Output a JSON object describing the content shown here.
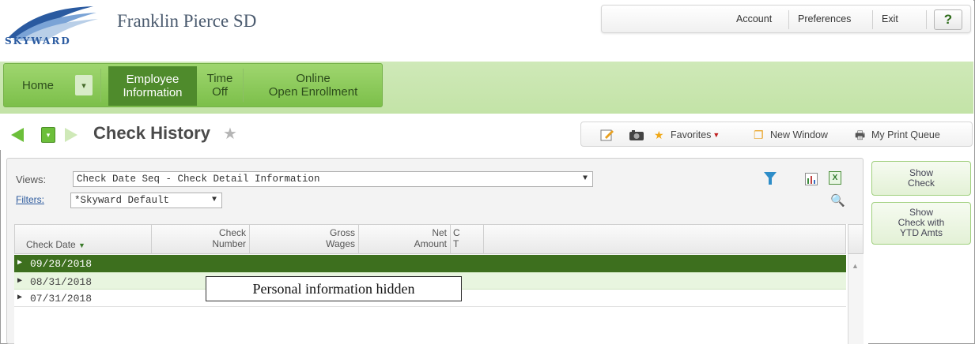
{
  "header": {
    "logo_text": "SKYWARD",
    "district": "Franklin Pierce SD",
    "menu": [
      "Account",
      "Preferences",
      "Exit"
    ],
    "help": "?"
  },
  "nav": {
    "home": "Home",
    "dropdown": "▾",
    "employee_information": "Employee\nInformation",
    "time_off": "Time\nOff",
    "online_open_enrollment": "Online\nOpen Enrollment"
  },
  "page": {
    "title": "Check History",
    "toolbar": {
      "favorites": "Favorites",
      "new_window": "New Window",
      "print_queue": "My Print Queue"
    }
  },
  "filters": {
    "views_label": "Views:",
    "views_value": "Check Date Seq - Check Detail Information",
    "filters_label": "Filters:",
    "filters_value": "*Skyward Default"
  },
  "grid": {
    "columns": [
      "Check Date",
      "Check\nNumber",
      "Gross\nWages",
      "Net\nAmount",
      "C\nT"
    ],
    "rows": [
      "09/28/2018",
      "08/31/2018",
      "07/31/2018"
    ]
  },
  "overlay_note": "Personal information hidden",
  "side_buttons": {
    "show_check": "Show\nCheck",
    "show_check_ytd": "Show\nCheck with\nYTD Amts"
  },
  "colors": {
    "nav_green": "#7cbf4a",
    "active_green": "#4f8b2c",
    "selected_row": "#3d6f1e",
    "alt_row": "#e8f5df"
  }
}
